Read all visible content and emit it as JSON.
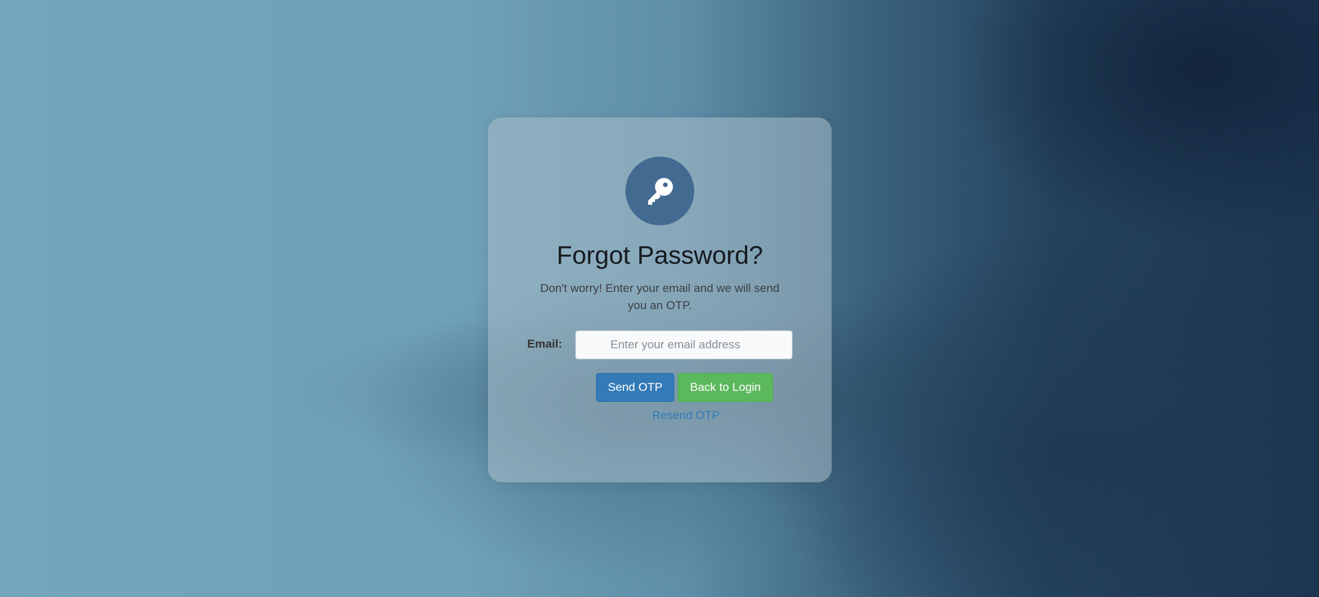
{
  "form": {
    "icon": "key-icon",
    "title": "Forgot Password?",
    "subtitle": "Don't worry! Enter your email and we will send you an OTP.",
    "email_label": "Email:",
    "email_placeholder": "Enter your email address",
    "email_value": "",
    "send_otp_label": "Send OTP",
    "back_to_login_label": "Back to Login",
    "resend_otp_label": "Resend OTP"
  },
  "colors": {
    "icon_circle": "#436a91",
    "primary_button": "#337ab7",
    "success_button": "#5cb85c",
    "link": "#337ab7"
  }
}
